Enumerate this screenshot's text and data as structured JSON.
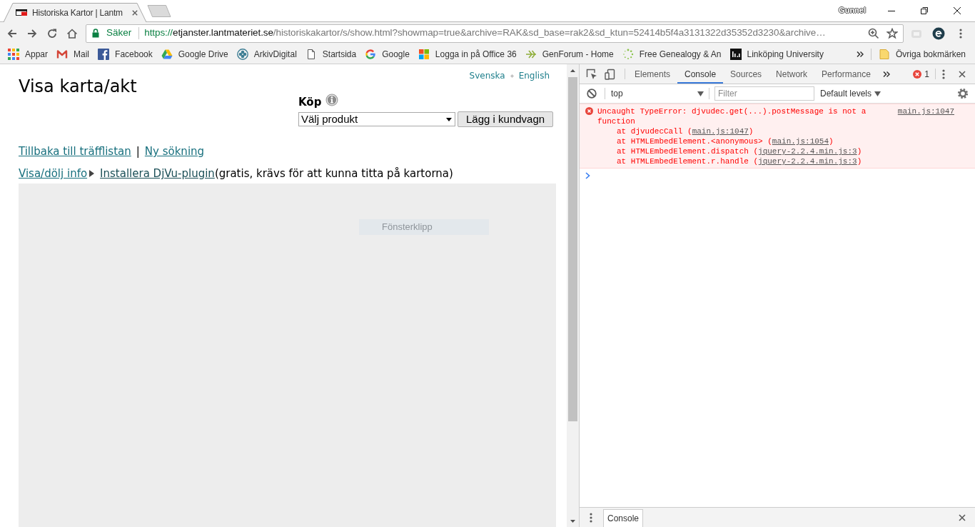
{
  "browser": {
    "tabs": [
      {
        "title": "Historiska Kartor | Lantm",
        "selected": true
      }
    ],
    "profile": "Gunnel",
    "address_bar": {
      "security_label": "Säker",
      "url_scheme": "https://",
      "url_host": "etjanster.lantmateriet.se",
      "url_rest": "/historiskakartor/s/show.html?showmap=true&archive=RAK&sd_base=rak2&sd_ktun=52414b5f4a3131322d35352d3230&archive…"
    },
    "bookmarks": [
      {
        "label": "Appar"
      },
      {
        "label": "Mail"
      },
      {
        "label": "Facebook"
      },
      {
        "label": "Google Drive"
      },
      {
        "label": "ArkivDigital"
      },
      {
        "label": "Startsida"
      },
      {
        "label": "Google"
      },
      {
        "label": "Logga in på Office 36"
      },
      {
        "label": "GenForum - Home"
      },
      {
        "label": "Free Genealogy & An"
      },
      {
        "label": "Linköping University"
      }
    ],
    "other_bookmarks": "Övriga bokmärken"
  },
  "page": {
    "languages": [
      {
        "label": "Svenska"
      },
      {
        "label": "English"
      }
    ],
    "title": "Visa karta/akt",
    "purchase": {
      "label": "Köp",
      "product_select": "Välj produkt",
      "add_button": "Lägg i kundvagn"
    },
    "nav_links": {
      "back": "Tillbaka till träfflistan",
      "separator": "|",
      "new_search": "Ny sökning"
    },
    "info_toggle": "Visa/dölj info",
    "plugin": {
      "link": "Installera DjVu-plugin",
      "note": "(gratis, krävs för att kunna titta på kartorna)"
    },
    "viewer": {
      "snip_label": "Fönsterklipp"
    }
  },
  "devtools": {
    "tabs": [
      {
        "label": "Elements",
        "selected": false
      },
      {
        "label": "Console",
        "selected": true
      },
      {
        "label": "Sources",
        "selected": false
      },
      {
        "label": "Network",
        "selected": false
      },
      {
        "label": "Performance",
        "selected": false
      }
    ],
    "error_count": "1",
    "console_toolbar": {
      "context": "top",
      "filter_placeholder": "Filter",
      "levels": "Default levels"
    },
    "messages": [
      {
        "kind": "error",
        "text": "Uncaught TypeError: djvudec.get(...).postMessage is not a function",
        "source": "main.js:1047",
        "stack": [
          {
            "text": "at djvudecCall (",
            "link": "main.js:1047",
            "suffix": ")"
          },
          {
            "text": "at HTMLEmbedElement.<anonymous> (",
            "link": "main.js:1054",
            "suffix": ")"
          },
          {
            "text": "at HTMLEmbedElement.dispatch (",
            "link": "jquery-2.2.4.min.js:3",
            "suffix": ")"
          },
          {
            "text": "at HTMLEmbedElement.r.handle (",
            "link": "jquery-2.2.4.min.js:3",
            "suffix": ")"
          }
        ]
      }
    ],
    "drawer": {
      "tabs": [
        {
          "label": "Console",
          "selected": true
        }
      ]
    }
  }
}
